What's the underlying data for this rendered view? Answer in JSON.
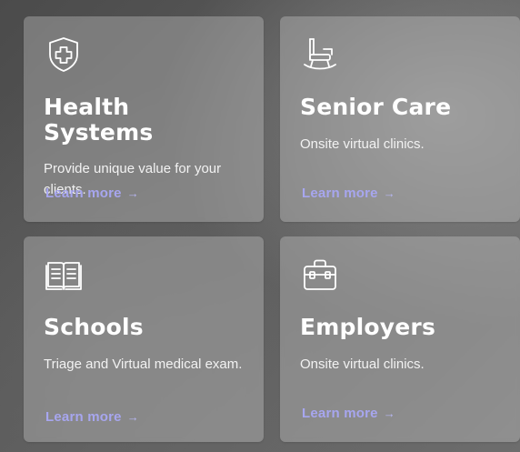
{
  "cards": [
    {
      "id": "health-systems",
      "icon": "shield-cross-icon",
      "title": "Health Systems",
      "description": "Provide unique value for your clients.",
      "link_label": "Learn more",
      "link_arrow": "→"
    },
    {
      "id": "senior-care",
      "icon": "rocking-chair-icon",
      "title": "Senior Care",
      "description": "Onsite virtual clinics.",
      "link_label": "Learn more",
      "link_arrow": "→"
    },
    {
      "id": "schools",
      "icon": "open-book-icon",
      "title": "Schools",
      "description": "Triage and Virtual medical exam.",
      "link_label": "Learn more",
      "link_arrow": "→"
    },
    {
      "id": "employers",
      "icon": "briefcase-icon",
      "title": "Employers",
      "description": "Onsite virtual clinics.",
      "link_label": "Learn more",
      "link_arrow": "→"
    }
  ],
  "colors": {
    "link": "#a7a6ef",
    "title": "#ffffff",
    "description": "#f2f2f2"
  }
}
